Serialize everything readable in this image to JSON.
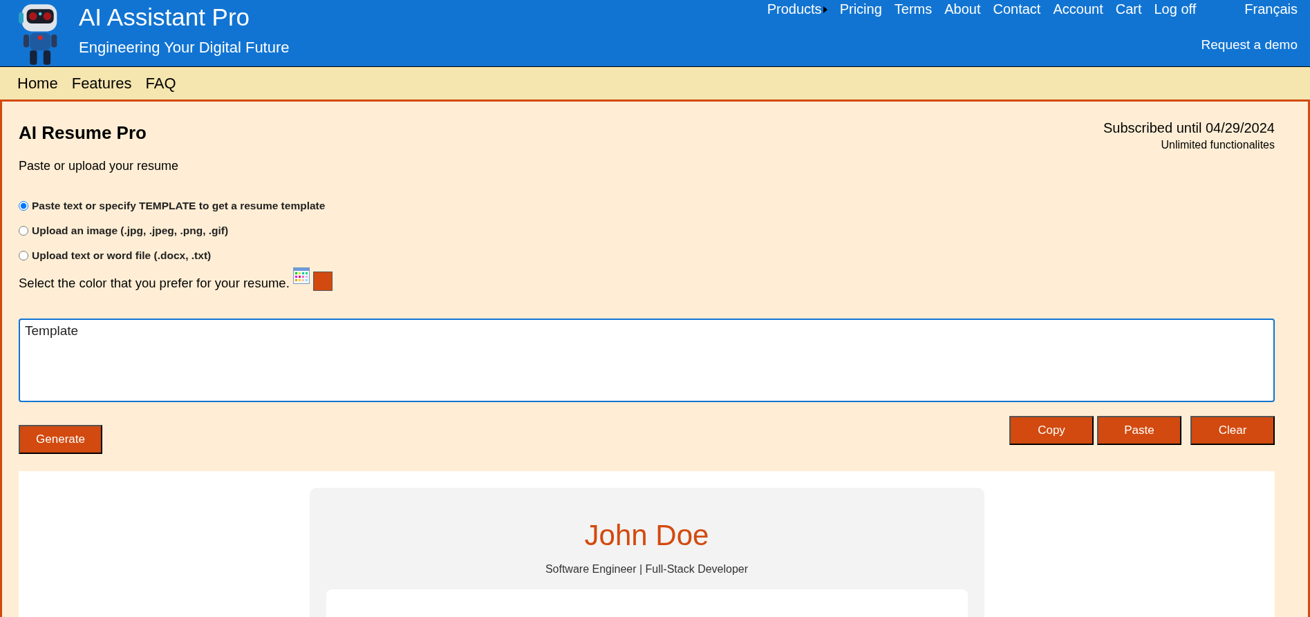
{
  "header": {
    "title": "AI Assistant Pro",
    "tagline": "Engineering Your Digital Future",
    "nav": [
      {
        "label": "Products",
        "has_submenu": true
      },
      {
        "label": "Pricing",
        "has_submenu": false
      },
      {
        "label": "Terms",
        "has_submenu": false
      },
      {
        "label": "About",
        "has_submenu": false
      },
      {
        "label": "Contact",
        "has_submenu": false
      },
      {
        "label": "Account",
        "has_submenu": false
      },
      {
        "label": "Cart",
        "has_submenu": false
      },
      {
        "label": "Log off",
        "has_submenu": false
      }
    ],
    "language": "Français",
    "demo_link": "Request a demo"
  },
  "subnav": [
    "Home",
    "Features",
    "FAQ"
  ],
  "main": {
    "title": "AI Resume Pro",
    "subscription": "Subscribed until 04/29/2024",
    "plan_note": "Unlimited functionalites",
    "instruction": "Paste or upload your resume",
    "options": [
      {
        "label": "Paste text or specify TEMPLATE to get a resume template",
        "selected": true
      },
      {
        "label": "Upload an image (.jpg, .jpeg, .png, .gif)",
        "selected": false
      },
      {
        "label": "Upload text or word file (.docx, .txt)",
        "selected": false
      }
    ],
    "color_prompt": "Select the color that you prefer for your resume.",
    "color_swatch": {
      "color": "#d24a0f"
    },
    "input": {
      "value": "Template"
    },
    "generate_button": "Generate",
    "actions": [
      "Copy",
      "Paste",
      "Clear"
    ]
  },
  "preview": {
    "name": "John Doe",
    "headline": "Software Engineer | Full-Stack Developer"
  }
}
